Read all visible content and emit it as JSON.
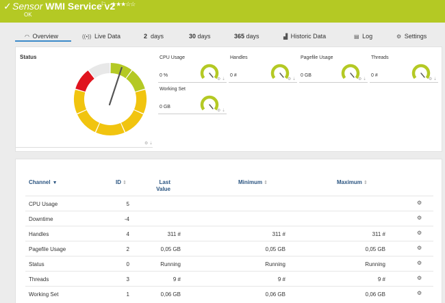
{
  "header": {
    "check": "✓",
    "kind": "Sensor",
    "name": "WMI Service v2",
    "flag": "⚐",
    "stars": "★★★☆☆",
    "status": "OK"
  },
  "tabs": [
    {
      "icon": "◠",
      "label": "Overview"
    },
    {
      "icon": "((•))",
      "label": "Live Data"
    },
    {
      "num": "2",
      "label": "days"
    },
    {
      "num": "30",
      "label": "days"
    },
    {
      "num": "365",
      "label": "days"
    },
    {
      "icon": "▟",
      "label": "Historic Data"
    },
    {
      "icon": "▤",
      "label": "Log"
    },
    {
      "icon": "⚙",
      "label": "Settings"
    }
  ],
  "status_panel": {
    "title": "Status",
    "gauge_level": 0.86,
    "segment_colors": {
      "green": "#b4c924",
      "yellow": "#f1c40f",
      "red": "#e0141e",
      "grey": "#e8e8e8"
    }
  },
  "mini_gauges": [
    {
      "label": "CPU Usage",
      "value": "0 %"
    },
    {
      "label": "Handles",
      "value": "0 #"
    },
    {
      "label": "Pagefile Usage",
      "value": "0 GB"
    },
    {
      "label": "Threads",
      "value": "0 #"
    },
    {
      "label": "Working Set",
      "value": "0 GB"
    }
  ],
  "table": {
    "headers": {
      "channel": "Channel",
      "id": "ID",
      "last_line1": "Last",
      "last_line2": "Value",
      "minimum": "Minimum",
      "maximum": "Maximum"
    },
    "rows": [
      {
        "channel": "CPU Usage",
        "id": "5",
        "last": "",
        "min": "",
        "max": ""
      },
      {
        "channel": "Downtime",
        "id": "-4",
        "last": "",
        "min": "",
        "max": ""
      },
      {
        "channel": "Handles",
        "id": "4",
        "last": "311 #",
        "min": "311 #",
        "max": "311 #"
      },
      {
        "channel": "Pagefile Usage",
        "id": "2",
        "last": "0,05 GB",
        "min": "0,05 GB",
        "max": "0,05 GB"
      },
      {
        "channel": "Status",
        "id": "0",
        "last": "Running",
        "min": "Running",
        "max": "Running"
      },
      {
        "channel": "Threads",
        "id": "3",
        "last": "9 #",
        "min": "9 #",
        "max": "9 #"
      },
      {
        "channel": "Working Set",
        "id": "1",
        "last": "0,06 GB",
        "min": "0,06 GB",
        "max": "0,06 GB"
      }
    ]
  }
}
